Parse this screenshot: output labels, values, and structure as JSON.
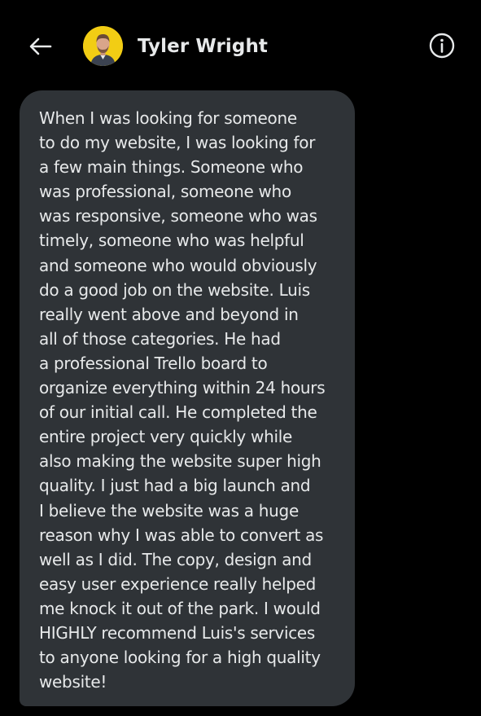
{
  "header": {
    "back_icon": "arrow-left-icon",
    "contact_name": "Tyler Wright",
    "avatar_background": "#f2cd14",
    "info_icon": "info-circle-icon"
  },
  "message": {
    "bubble_color": "#2f3337",
    "lines": [
      "When I was looking for someone",
      "to do my website, I was looking for",
      "a few main things. Someone who",
      "was professional, someone who",
      "was responsive, someone who was",
      "timely, someone who was helpful",
      "and someone who would obviously",
      "do a good job on the website. Luis",
      "really went above and beyond in",
      "all of those categories. He had",
      "a professional Trello board to",
      "organize everything within 24 hours",
      "of our initial call. He completed the",
      "entire project very quickly while",
      "also making the website super high",
      "quality. I just had a big launch and",
      "I believe the website was a huge",
      "reason why I was able to convert as",
      "well as I did. The copy, design and",
      "easy user experience really helped",
      "me knock it out of the park. I would",
      "HIGHLY recommend Luis's services",
      "to anyone looking for a high quality",
      "website!"
    ]
  }
}
